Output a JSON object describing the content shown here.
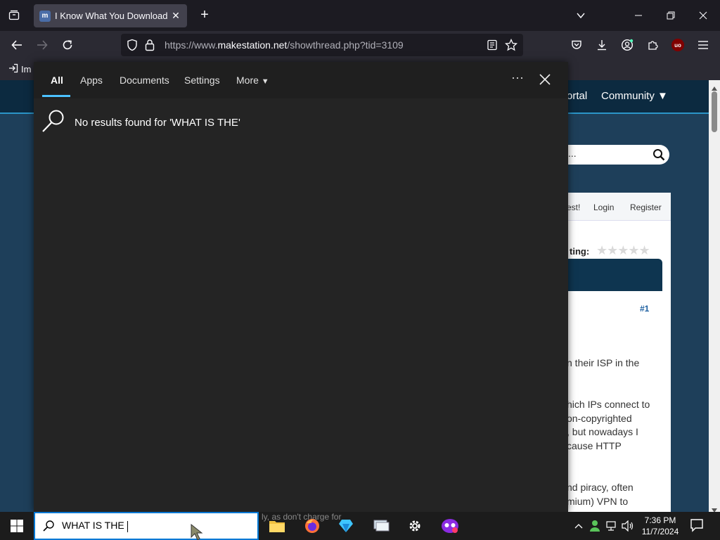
{
  "browser": {
    "tab": {
      "favicon_letter": "m",
      "title": "I Know What You Download...",
      "close": "✕"
    },
    "new_tab": "+",
    "url": {
      "prefix": "https://www.",
      "domain": "makestation.net",
      "path": "/showthread.php?tid=3109"
    },
    "bookmark": {
      "label": "Im"
    },
    "addon_badge": "uo"
  },
  "webpage": {
    "nav_items": [
      "ortal",
      "Community ▼"
    ],
    "search_placeholder": "...",
    "panel_links": [
      "est!",
      "Login",
      "Register"
    ],
    "rating_label": "ting:",
    "stars": "★★★★★",
    "post_number": "#1",
    "post_lines": [
      "n their ISP in the",
      "hich IPs connect to",
      "on-copyrighted",
      ", but nowadays I",
      "cause HTTP",
      "nd piracy, often",
      "mium) VPN to"
    ]
  },
  "search_flyout": {
    "tabs": [
      "All",
      "Apps",
      "Documents",
      "Settings",
      "More"
    ],
    "more_arrow": "▼",
    "overflow": "···",
    "no_results_message": "No results found for 'WHAT IS THE'"
  },
  "taskbar": {
    "search_query": "WHAT IS THE",
    "behind_text": "ly, as don't charge for",
    "apps": [
      "file-explorer",
      "firefox",
      "gem-app",
      "network-app",
      "settings",
      "mask-app"
    ],
    "time": "7:36 PM",
    "date": "11/7/2024"
  },
  "colors": {
    "accent": "#4cc2ff",
    "flyout_bg": "#242424",
    "page_bg": "#1e3f5a"
  }
}
